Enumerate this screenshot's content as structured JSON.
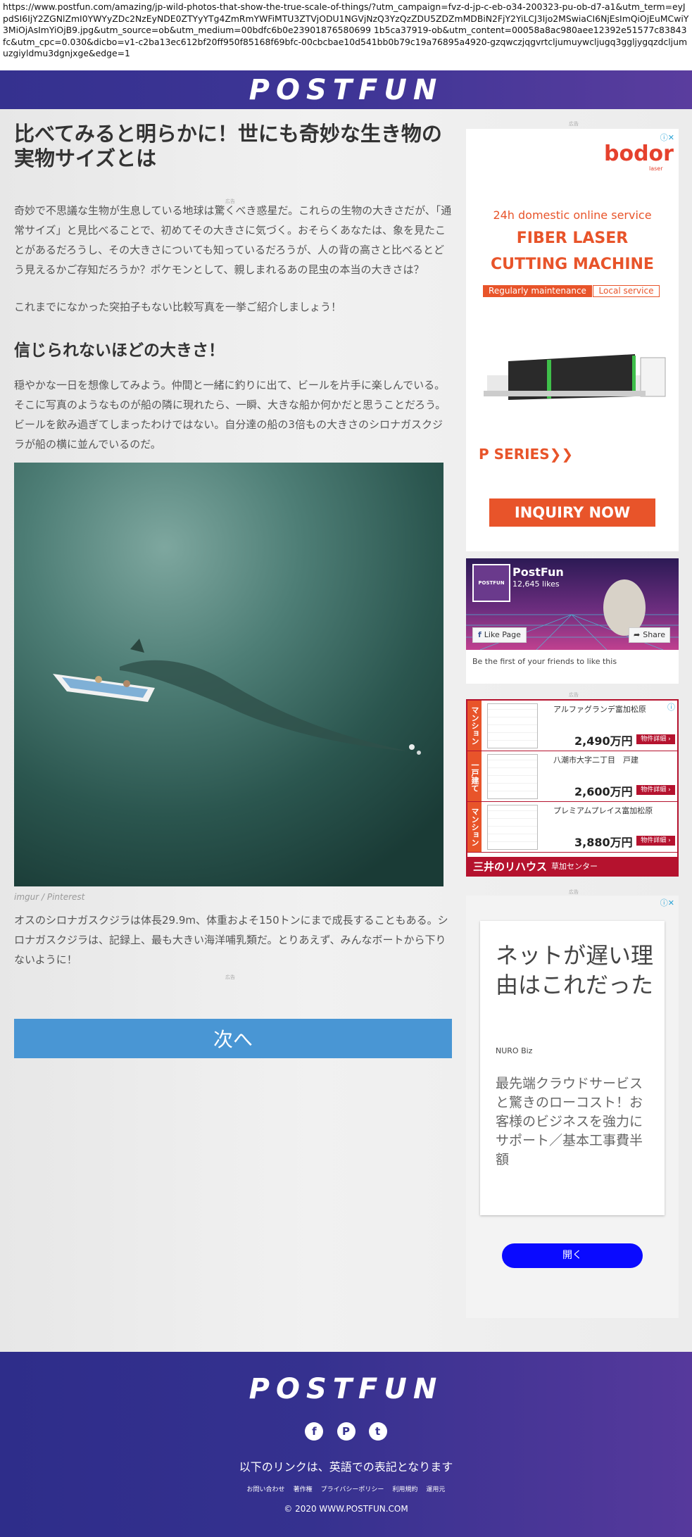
{
  "url": "https://www.postfun.com/amazing/jp-wild-photos-that-show-the-true-scale-of-things/?utm_campaign=fvz-d-jp-c-eb-o34-200323-pu-ob-d7-a1&utm_term=eyJpdSI6IjY2ZGNlZmI0YWYyZDc2NzEyNDE0ZTYyYTg4ZmRmYWFiMTU3ZTVjODU1NGVjNzQ3YzQzZDU5ZDZmMDBiN2FjY2YiLCJ3Ijo2MSwiaCI6NjEsImQiOjEuMCwiY3MiOjAsImYiOjB9.jpg&utm_source=ob&utm_medium=00bdfc6b0e23901876580699 1b5ca37919-ob&utm_content=00058a8ac980aee12392e51577c83843fc&utm_cpc=0.030&dicbo=v1-c2ba13ec612bf20ff950f85168f69bfc-00cbcbae10d541bb0b79c19a76895a4920-gzqwczjqgvrtcljumuywcljugq3ggljygqzdcljumuzgiyldmu3dgnjxge&edge=1",
  "header": {
    "logo": "POSTFUN"
  },
  "article": {
    "title": "比べてみると明らかに！世にも奇妙な生き物の実物サイズとは",
    "ad_label": "広告",
    "intro": "奇妙で不思議な生物が生息している地球は驚くべき惑星だ。これらの生物の大きさだが、「通常サイズ」と見比べることで、初めてその大きさに気づく。おそらくあなたは、象を見たことがあるだろうし、その大きさについても知っているだろうが、人の背の高さと比べるとどう見えるかご存知だろうか？ポケモンとして、親しまれるあの昆虫の本当の大きさは？",
    "intro2": "これまでになかった突拍子もない比較写真を一挙ご紹介しましょう！",
    "heading": "信じられないほどの大きさ！",
    "body": "穏やかな一日を想像してみよう。仲間と一緒に釣りに出て、ビールを片手に楽しんでいる。そこに写真のようなものが船の隣に現れたら、一瞬、大きな船か何かだと思うことだろう。ビールを飲み過ぎてしまったわけではない。自分達の船の3倍もの大きさのシロナガスクジラが船の横に並んでいるのだ。",
    "caption": "imgur / Pinterest",
    "body2": "オスのシロナガスクジラは体長29.9m、体重およそ150トンにまで成長することもある。シロナガスクジラは、記録上、最も大きい海洋哺乳類だ。とりあえず、みんなボートから下りないように！",
    "next_label": "次へ"
  },
  "sidebar": {
    "ad_label": "広告",
    "ad1": {
      "brand": "bodor",
      "brand_sub": "laser",
      "service": "24h domestic online service",
      "line1": "FIBER LASER",
      "line2": "CUTTING MACHINE",
      "tag1": "Regularly maintenance",
      "tag2": "Local service",
      "series": "P SERIES",
      "cta": "INQUIRY NOW"
    },
    "facebook": {
      "name": "PostFun",
      "likes": "12,645 likes",
      "like_page": "Like Page",
      "share": "Share",
      "friends": "Be the first of your friends to like this",
      "avatar_text": "POSTFUN"
    },
    "ad2": {
      "rows": [
        {
          "tag": "マンション",
          "name": "アルファグランデ富加松原",
          "price": "2,490万円",
          "btn": "物件詳細"
        },
        {
          "tag": "一戸建て",
          "name": "八潮市大字二丁目　戸建",
          "price": "2,600万円",
          "btn": "物件詳細"
        },
        {
          "tag": "マンション",
          "name": "プレミアムプレイス富加松原",
          "price": "3,880万円",
          "btn": "物件詳細"
        }
      ],
      "footer_brand": "三井のリハウス",
      "footer_center": "草加センター"
    },
    "ad3": {
      "headline": "ネットが遅い理由はこれだった",
      "source": "NURO Biz",
      "body": "最先端クラウドサービスと驚きのローコスト！お客様のビジネスを強力にサポート／基本工事費半額",
      "cta": "開く"
    }
  },
  "footer": {
    "logo": "POSTFUN",
    "note": "以下のリンクは、英語での表記となります",
    "links": [
      "お問い合わせ",
      "著作権",
      "プライバシーポリシー",
      "利用規約",
      "運用元"
    ],
    "copyright": "© 2020 WWW.POSTFUN.COM"
  },
  "colors": {
    "header": "#35318f",
    "next_button": "#4996d4",
    "ad_red": "#e8542a",
    "ad3_button": "#0a0aff"
  }
}
